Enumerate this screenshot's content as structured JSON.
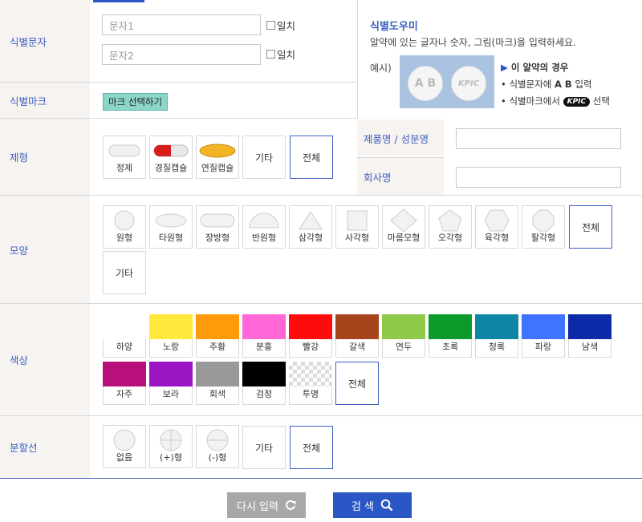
{
  "rows": {
    "id_text": {
      "label": "식별문자",
      "input1_placeholder": "문자1",
      "input2_placeholder": "문자2",
      "match_label": "일치"
    },
    "id_mark": {
      "label": "식별마크",
      "button": "마크 선택하기"
    },
    "form": {
      "label": "제형",
      "product_label": "제품명 / 성분명",
      "company_label": "회사명"
    },
    "shape": {
      "label": "모양"
    },
    "color": {
      "label": "색상"
    },
    "score": {
      "label": "분할선"
    }
  },
  "helper": {
    "title": "식별도우미",
    "description": "알약에 있는 글자나 숫자, 그림(마크)을 입력하세요.",
    "example_label": "예시)",
    "pill_text": "A B",
    "pill_mark": "KPIC",
    "case_title": "이 알약의 경우",
    "step1_pre": "식별문자에 ",
    "step1_bold": "A B",
    "step1_post": "입력",
    "step2_pre": "식별마크에서",
    "step2_mark": "KPIC",
    "step2_post": "선택"
  },
  "forms": [
    "정제",
    "경질캡슐",
    "연질캡슐",
    "기타",
    "전체"
  ],
  "shapes": [
    "원형",
    "타원형",
    "장방형",
    "반원형",
    "삼각형",
    "사각형",
    "마름모형",
    "오각형",
    "육각형",
    "팔각형",
    "전체",
    "기타"
  ],
  "colors": {
    "all": "전체",
    "items": [
      {
        "label": "하양",
        "hex": "#ffffff"
      },
      {
        "label": "노랑",
        "hex": "#ffe93a"
      },
      {
        "label": "주황",
        "hex": "#ff9a0a"
      },
      {
        "label": "분홍",
        "hex": "#ff66d6"
      },
      {
        "label": "빨강",
        "hex": "#ff0b0b"
      },
      {
        "label": "갈색",
        "hex": "#a8441c"
      },
      {
        "label": "연두",
        "hex": "#8fc94a"
      },
      {
        "label": "초록",
        "hex": "#0c9a2a"
      },
      {
        "label": "청록",
        "hex": "#0f86a6"
      },
      {
        "label": "파랑",
        "hex": "#3f74ff"
      },
      {
        "label": "남색",
        "hex": "#0d2aa8"
      },
      {
        "label": "자주",
        "hex": "#b8107a"
      },
      {
        "label": "보라",
        "hex": "#9b14c4"
      },
      {
        "label": "회색",
        "hex": "#999999"
      },
      {
        "label": "검정",
        "hex": "#000000"
      },
      {
        "label": "투명",
        "hex": "checker"
      }
    ]
  },
  "score": [
    "없음",
    "(+)형",
    "(-)형",
    "기타",
    "전체"
  ],
  "buttons": {
    "reset": "다시 입력",
    "search": "검 색"
  }
}
